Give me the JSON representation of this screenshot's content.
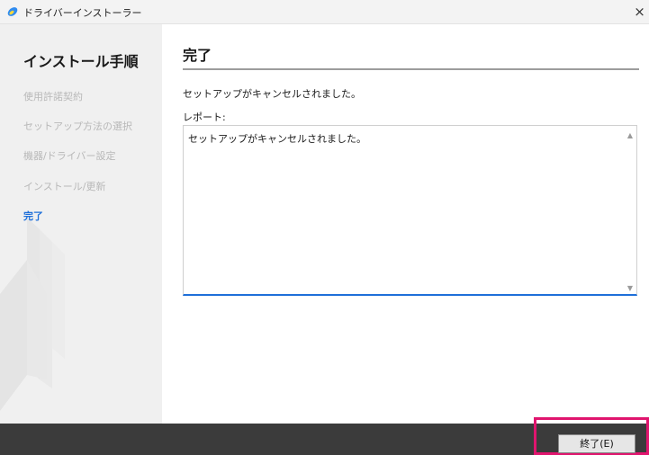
{
  "window": {
    "title": "ドライバーインストーラー",
    "close_symbol": "×"
  },
  "sidebar": {
    "heading": "インストール手順",
    "steps": [
      {
        "label": "使用許諾契約",
        "active": false
      },
      {
        "label": "セットアップ方法の選択",
        "active": false
      },
      {
        "label": "機器/ドライバー設定",
        "active": false
      },
      {
        "label": "インストール/更新",
        "active": false
      },
      {
        "label": "完了",
        "active": true
      }
    ]
  },
  "main": {
    "title": "完了",
    "message": "セットアップがキャンセルされました。",
    "report_label": "レポート:",
    "report_text": "セットアップがキャンセルされました。"
  },
  "footer": {
    "finish_label": "終了(E)"
  },
  "colors": {
    "accent": "#1e6fd9",
    "highlight": "#e0156e",
    "footer_bg": "#3b3b3b",
    "sidebar_bg": "#f0f0f0"
  }
}
